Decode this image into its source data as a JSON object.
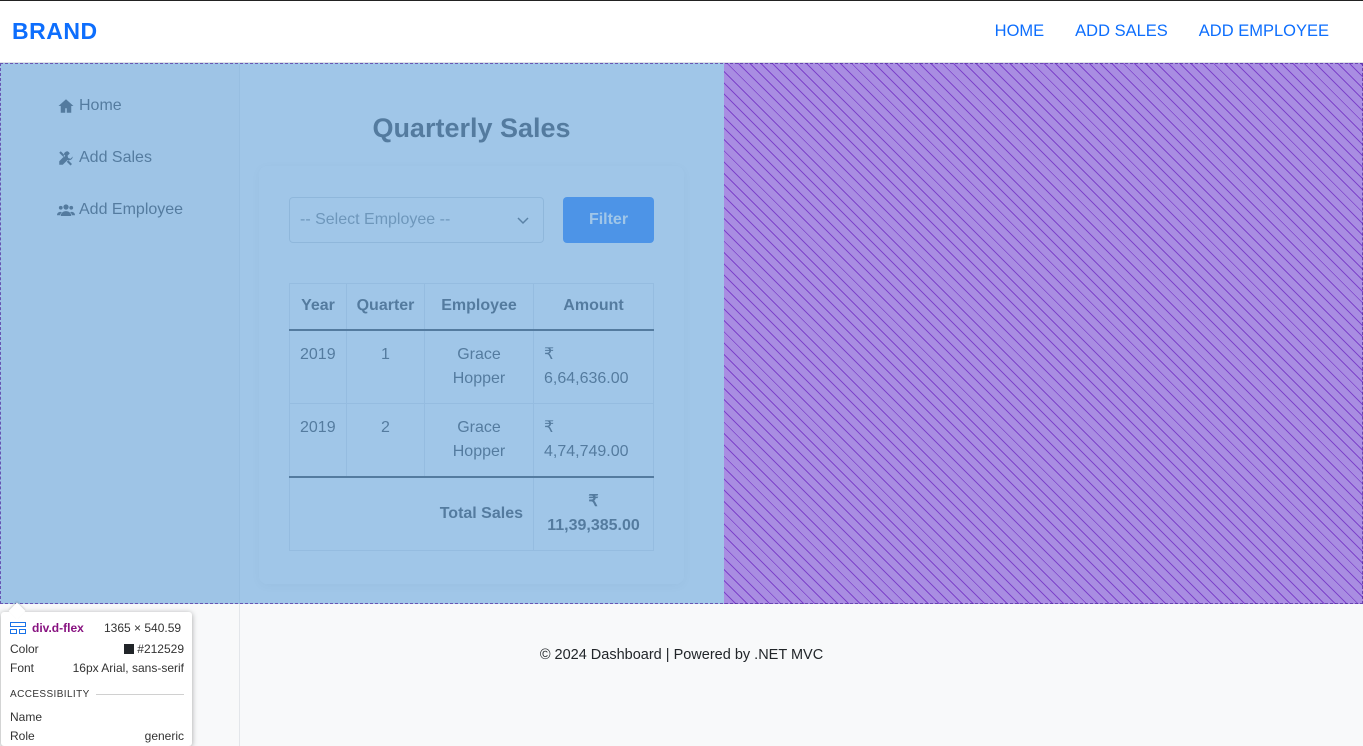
{
  "navbar": {
    "brand": "BRAND",
    "links": [
      "HOME",
      "ADD SALES",
      "ADD EMPLOYEE"
    ],
    "accent": "#0d6efd"
  },
  "sidebar": {
    "items": [
      {
        "icon": "home-icon",
        "label": "Home"
      },
      {
        "icon": "tools-icon",
        "label": "Add Sales"
      },
      {
        "icon": "users-icon",
        "label": "Add Employee"
      }
    ]
  },
  "main": {
    "title": "Quarterly Sales",
    "select_placeholder": "-- Select Employee --",
    "filter_label": "Filter",
    "table": {
      "headers": [
        "Year",
        "Quarter",
        "Employee",
        "Amount"
      ],
      "rows": [
        {
          "year": "2019",
          "quarter": "1",
          "employee": "Grace Hopper",
          "amount": "₹ 6,64,636.00"
        },
        {
          "year": "2019",
          "quarter": "2",
          "employee": "Grace Hopper",
          "amount": "₹ 4,74,749.00"
        }
      ],
      "total_label": "Total Sales",
      "total_value": "₹ 11,39,385.00"
    }
  },
  "footer": {
    "text": "© 2024 Dashboard | Powered by .NET MVC"
  },
  "devtools_tooltip": {
    "element": "div.d-flex",
    "size": "1365 × 540.59",
    "color_label": "Color",
    "color_value": "#212529",
    "font_label": "Font",
    "font_value": "16px Arial, sans-serif",
    "section": "ACCESSIBILITY",
    "name_label": "Name",
    "name_value": "",
    "role_label": "Role",
    "role_value": "generic"
  }
}
